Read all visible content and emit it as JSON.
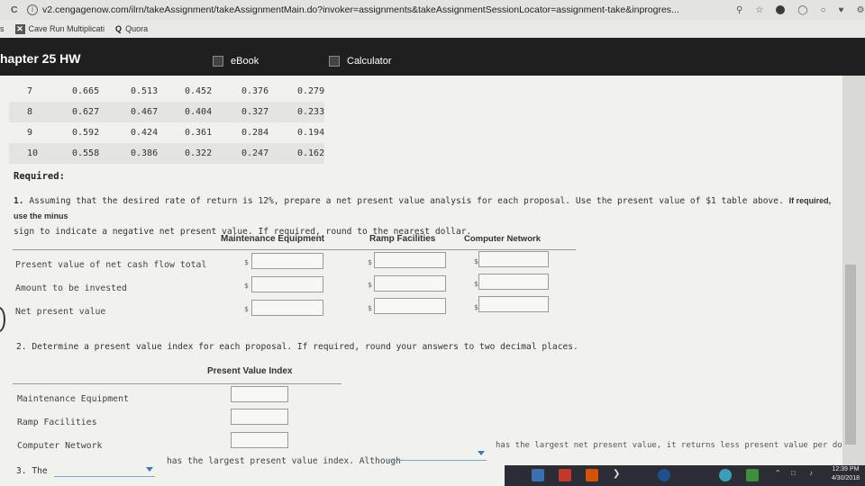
{
  "browser": {
    "url": "v2.cengagenow.com/ilrn/takeAssignment/takeAssignmentMain.do?invoker=assignments&takeAssignmentSessionLocator=assignment-take&inprogres...",
    "bookmarks": [
      {
        "label": "Cave Run Multiplicati",
        "icon": "x-icon"
      },
      {
        "label": "Quora",
        "icon": "quora-icon"
      }
    ],
    "bookmarks_prefix": "s"
  },
  "toolbar": {
    "chapter_title": "hapter 25 HW",
    "ebook_label": "eBook",
    "calculator_label": "Calculator"
  },
  "pv_table": {
    "rows": [
      {
        "period": "7",
        "values": [
          "0.665",
          "0.513",
          "0.452",
          "0.376",
          "0.279"
        ]
      },
      {
        "period": "8",
        "values": [
          "0.627",
          "0.467",
          "0.404",
          "0.327",
          "0.233"
        ]
      },
      {
        "period": "9",
        "values": [
          "0.592",
          "0.424",
          "0.361",
          "0.284",
          "0.194"
        ]
      },
      {
        "period": "10",
        "values": [
          "0.558",
          "0.386",
          "0.322",
          "0.247",
          "0.162"
        ]
      }
    ]
  },
  "required_label": "Required:",
  "q1": {
    "number": "1.",
    "text_a": "Assuming that the desired rate of return is 12%, prepare a net present value analysis for each proposal. Use the present value of $1 table above.",
    "text_b": "If required, use the minus",
    "text_c": "sign to indicate a negative net present value. If required, round to the nearest dollar.",
    "columns": [
      "Maintenance Equipment",
      "Ramp Facilities",
      "Computer Network"
    ],
    "rows": [
      "Present value of net cash flow total",
      "Amount to be invested",
      "Net present value"
    ],
    "currency": "$"
  },
  "q2": {
    "text": "2. Determine a present value index for each proposal. If required, round your answers to two decimal places.",
    "column": "Present Value Index",
    "rows": [
      "Maintenance Equipment",
      "Ramp Facilities",
      "Computer Network"
    ]
  },
  "q3": {
    "number": "3. The",
    "mid_text": "has the largest present value index. Although",
    "end_text": "has the largest net present value, it returns less present value per dollar"
  },
  "taskbar": {
    "time": "12:39 PM",
    "date": "4/30/2018"
  }
}
